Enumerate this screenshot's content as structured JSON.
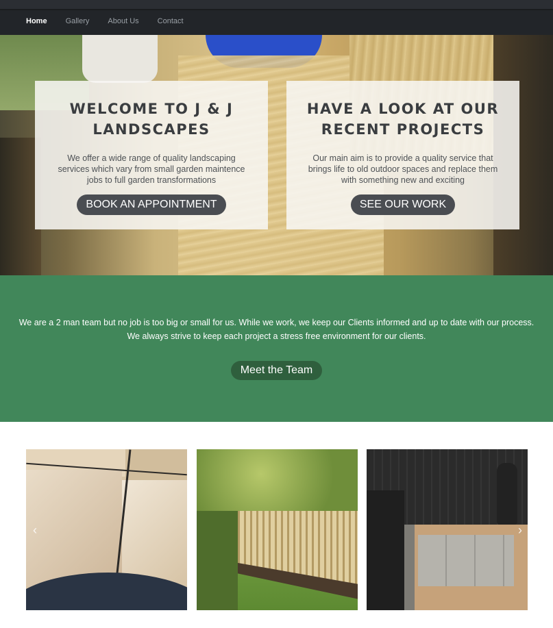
{
  "nav": {
    "items": [
      {
        "label": "Home",
        "active": true
      },
      {
        "label": "Gallery",
        "active": false
      },
      {
        "label": "About Us",
        "active": false
      },
      {
        "label": "Contact",
        "active": false
      }
    ]
  },
  "hero": {
    "left_card": {
      "title": "WELCOME TO J & J LANDSCAPES",
      "text": "We offer a wide range of quality landscaping services which vary from small garden maintence jobs to full garden transformations",
      "button": "BOOK AN APPOINTMENT"
    },
    "right_card": {
      "title": "HAVE A LOOK AT OUR RECENT PROJECTS",
      "text": "Our main aim is to provide a quality service that brings life to old outdoor spaces and replace them with something new and exciting",
      "button": "SEE OUR WORK"
    }
  },
  "band": {
    "text": "We are a 2 man team but no job is too big or small for us. While we work, we keep our Clients informed and up to date with our process. We always strive to keep each project a stress free environment for our clients.",
    "button": "Meet the Team"
  },
  "gallery": {
    "prev_icon": "chevron-left-icon",
    "next_icon": "chevron-right-icon",
    "prev_glyph": "‹",
    "next_glyph": "›"
  },
  "colors": {
    "nav_bg": "#222529",
    "band_bg": "#41875a",
    "button_dark": "#4a4d52",
    "button_green": "#2f5f3d"
  }
}
